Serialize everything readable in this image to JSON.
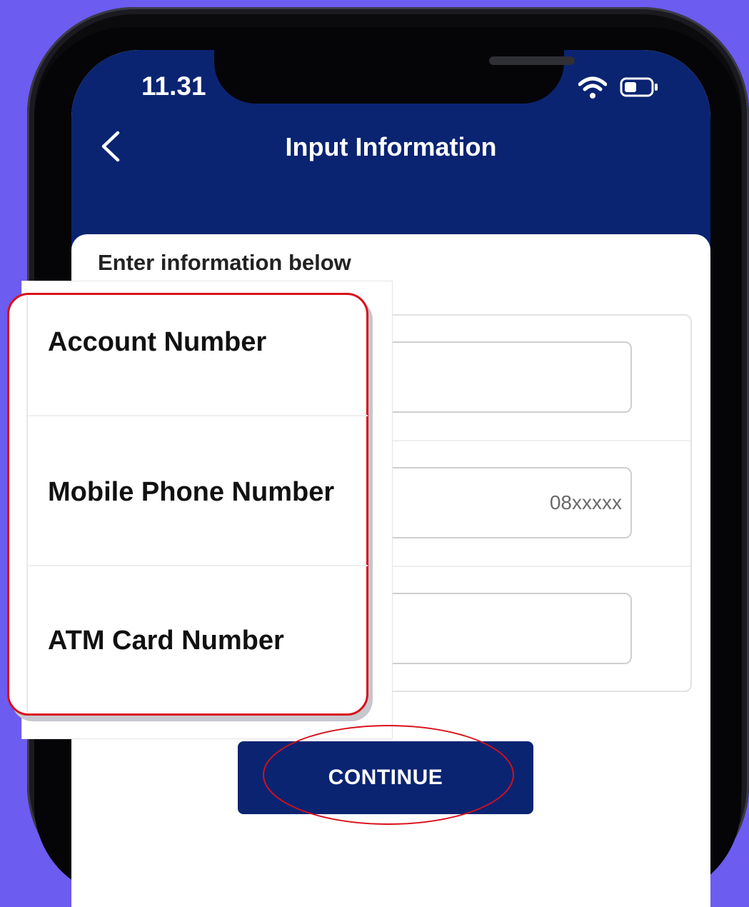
{
  "status_bar": {
    "time": "11.31"
  },
  "header": {
    "title": "Input Information"
  },
  "form": {
    "section_label": "Enter information below",
    "fields": [
      {
        "label": "Account Number",
        "value": "",
        "placeholder": ""
      },
      {
        "label": "Mobile Phone Number",
        "value": "",
        "placeholder": "08xxxxx"
      },
      {
        "label": "ATM Card Number",
        "value": "",
        "placeholder": ""
      }
    ],
    "continue_label": "CONTINUE"
  },
  "icons": {
    "back": "chevron-left-icon",
    "wifi": "wifi-icon",
    "battery": "battery-icon"
  },
  "colors": {
    "primary": "#0a2472",
    "background": "#6c5cf0",
    "highlight": "#d90f1a"
  }
}
